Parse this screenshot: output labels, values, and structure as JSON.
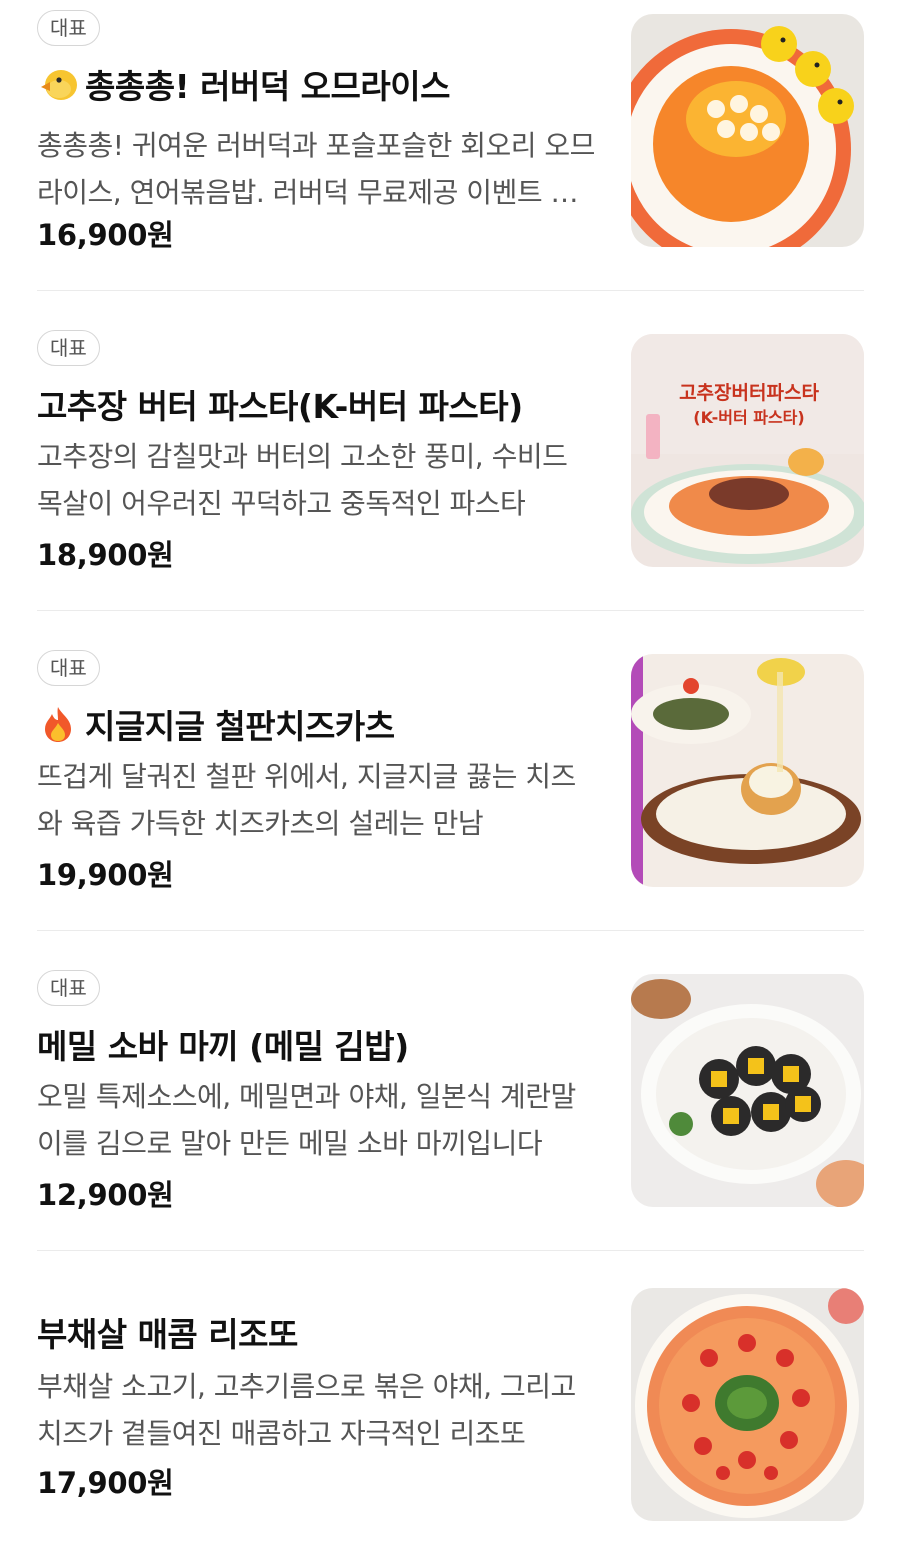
{
  "menu": {
    "badge_label": "대표",
    "items": [
      {
        "badge": "대표",
        "name": "총총총! 러버덕 오므라이스",
        "emoji_icon": "chick-icon",
        "description": "총총총! 귀여운 러버덕과 포슬포슬한 회오리 오므라이스, 연어볶음밥. 러버덕 무료제공 이벤트 진행중!",
        "price": "16,900원",
        "image_label": "rubber-duck-omurice-photo"
      },
      {
        "badge": "대표",
        "name": "고추장 버터 파스타(K-버터 파스타)",
        "emoji_icon": "",
        "description": "고추장의 감칠맛과 버터의 고소한 풍미, 수비드 목살이 어우러진 꾸덕하고 중독적인 파스타",
        "price": "18,900원",
        "image_label": "gochujang-butter-pasta-photo",
        "image_caption_1": "고추장버터파스타",
        "image_caption_2": "(K-버터 파스타)"
      },
      {
        "badge": "대표",
        "name": "지글지글 철판치즈카츠",
        "emoji_icon": "fire-icon",
        "description": "뜨겁게 달궈진 철판 위에서, 지글지글 끓는 치즈와 육즙 가득한 치즈카츠의 설레는 만남",
        "price": "19,900원",
        "image_label": "sizzling-cheese-katsu-photo"
      },
      {
        "badge": "대표",
        "name": "메밀 소바 마끼 (메밀 김밥)",
        "emoji_icon": "",
        "description": "오밀 특제소스에, 메밀면과 야채, 일본식 계란말이를 김으로 말아 만든 메밀 소바 마끼입니다",
        "price": "12,900원",
        "image_label": "soba-maki-photo"
      },
      {
        "badge": "",
        "name": "부채살 매콤 리조또",
        "emoji_icon": "",
        "description": "부채살 소고기, 고추기름으로 볶은 야채, 그리고 치즈가 곁들여진 매콤하고 자극적인 리조또",
        "price": "17,900원",
        "image_label": "spicy-beef-risotto-photo"
      }
    ]
  }
}
